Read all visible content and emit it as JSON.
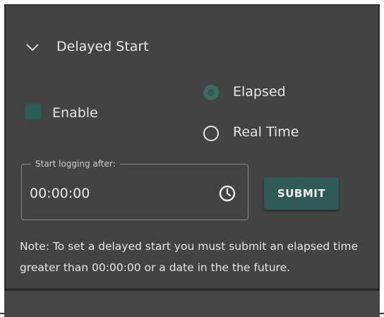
{
  "section": {
    "title": "Delayed Start",
    "chevron_icon": "chevron-down-icon"
  },
  "enable": {
    "label": "Enable",
    "checked": true
  },
  "mode": {
    "options": [
      {
        "label": "Elapsed",
        "selected": true
      },
      {
        "label": "Real Time",
        "selected": false
      }
    ]
  },
  "start_field": {
    "legend": "Start logging after:",
    "value": "00:00:00",
    "icon": "clock-icon"
  },
  "submit": {
    "label": "SUBMIT"
  },
  "note": "Note: To set a delayed start you must submit an elapsed time greater than 00:00:00 or a date in the the future.",
  "colors": {
    "panel_bg": "#434343",
    "accent": "#2f5a55",
    "text": "#e6e6e6"
  }
}
